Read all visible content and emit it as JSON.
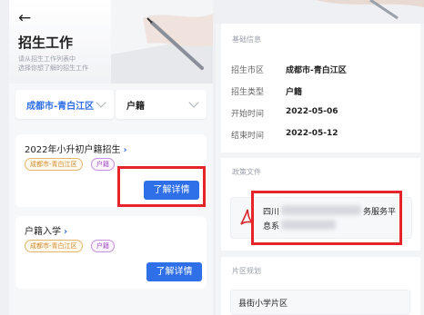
{
  "left": {
    "back_icon": "arrow-left",
    "title": "招生工作",
    "subtitle_lines": [
      "请从招生工作列表中",
      "选择你想了解的招生工作"
    ],
    "filters": {
      "district": "成都市-青白江区",
      "type": "户籍"
    },
    "cards": [
      {
        "title": "2022年小升初户籍招生",
        "arrow": "›",
        "tags": [
          "成都市-青白江区",
          "户籍"
        ],
        "button": "了解详情"
      },
      {
        "title": "户籍入学",
        "arrow": "›",
        "tags": [
          "成都市-青白江区",
          "户籍"
        ],
        "button": "了解详情"
      }
    ]
  },
  "right": {
    "basic_info_title": "基础信息",
    "rows": [
      {
        "key": "招生市区",
        "value": "成都市-青白江区"
      },
      {
        "key": "招生类型",
        "value": "户籍"
      },
      {
        "key": "开始时间",
        "value": "2022-05-06"
      },
      {
        "key": "结束时间",
        "value": "2022-05-12"
      }
    ],
    "policy_title": "政策文件",
    "file_line1_a": "四川",
    "file_line1_b": "务服务平",
    "file_line2": "息系",
    "area_title": "片区规划",
    "area_item": "县街小学片区"
  },
  "colors": {
    "accent": "#2f6fe8",
    "highlight": "#e8242b",
    "tag_orange": "#d18a2a",
    "tag_purple": "#a24fc4"
  }
}
